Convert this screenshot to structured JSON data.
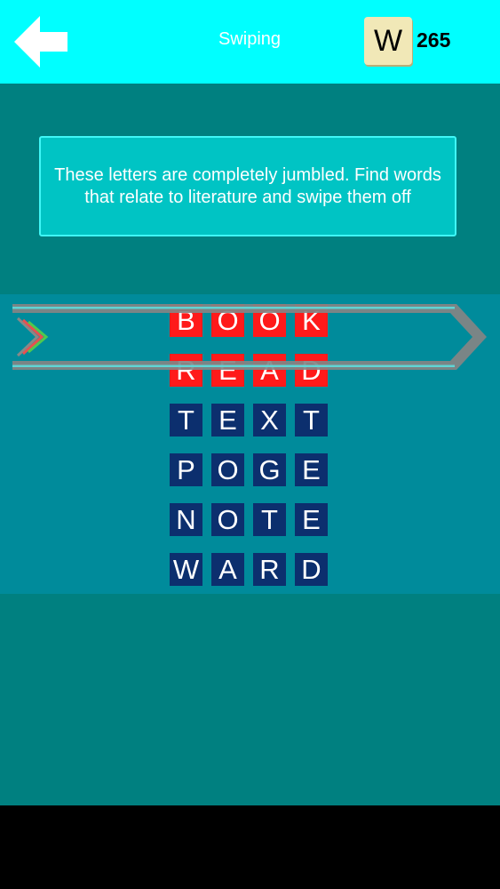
{
  "header": {
    "title": "Swiping",
    "coin_letter": "W",
    "coin_count": "265"
  },
  "instructions": "These letters are completely jumbled. Find words that relate to literature and swipe them off",
  "words": [
    {
      "text": "BOOK",
      "letters": [
        "B",
        "O",
        "O",
        "K"
      ],
      "found": true
    },
    {
      "text": "READ",
      "letters": [
        "R",
        "E",
        "A",
        "D"
      ],
      "found": true
    },
    {
      "text": "TEXT",
      "letters": [
        "T",
        "E",
        "X",
        "T"
      ],
      "found": false
    },
    {
      "text": "POGE",
      "letters": [
        "P",
        "O",
        "G",
        "E"
      ],
      "found": false
    },
    {
      "text": "NOTE",
      "letters": [
        "N",
        "O",
        "T",
        "E"
      ],
      "found": false
    },
    {
      "text": "WARD",
      "letters": [
        "W",
        "A",
        "R",
        "D"
      ],
      "found": false
    }
  ],
  "icons": {
    "back": "left-arrow-icon",
    "swipe": "swipe-arrow-icon"
  },
  "colors": {
    "topbar": "#00ffff",
    "background": "#008080",
    "board": "#008b9b",
    "found_tile": "#ff1a1a",
    "unfound_tile": "#0c2f6e",
    "instructions_box": "#00c4c4"
  }
}
